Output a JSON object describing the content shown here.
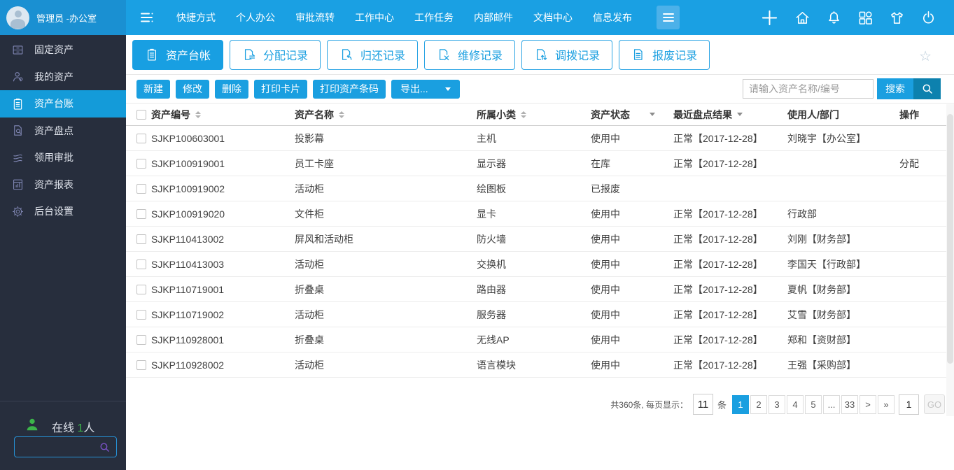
{
  "topbar": {
    "user_name": "管理员 -办公室",
    "menu": [
      "快捷方式",
      "个人办公",
      "审批流转",
      "工作中心",
      "工作任务",
      "内部邮件",
      "文档中心",
      "信息发布"
    ],
    "right_icons": [
      "plus-icon",
      "home-icon",
      "bell-icon",
      "apps-icon",
      "tshirt-icon",
      "power-icon"
    ]
  },
  "sidebar": {
    "items": [
      {
        "label": "固定资产",
        "icon": "cabinet-icon",
        "active": false
      },
      {
        "label": "我的资产",
        "icon": "user-icon",
        "active": false
      },
      {
        "label": "资产台账",
        "icon": "clipboard-icon",
        "active": true
      },
      {
        "label": "资产盘点",
        "icon": "doc-search-icon",
        "active": false
      },
      {
        "label": "领用审批",
        "icon": "layers-icon",
        "active": false
      },
      {
        "label": "资产报表",
        "icon": "report-icon",
        "active": false
      },
      {
        "label": "后台设置",
        "icon": "gear-icon",
        "active": false
      }
    ],
    "online_label": "在线",
    "online_count": "1",
    "online_unit": "人"
  },
  "tabs": [
    {
      "label": "资产台帐",
      "icon": "clipboard-icon",
      "active": true
    },
    {
      "label": "分配记录",
      "icon": "doc-swap-icon",
      "active": false
    },
    {
      "label": "归还记录",
      "icon": "doc-return-icon",
      "active": false
    },
    {
      "label": "维修记录",
      "icon": "doc-repair-icon",
      "active": false
    },
    {
      "label": "调拨记录",
      "icon": "doc-transfer-icon",
      "active": false
    },
    {
      "label": "报废记录",
      "icon": "doc-scrap-icon",
      "active": false
    }
  ],
  "toolbar": {
    "buttons": [
      "新建",
      "修改",
      "删除",
      "打印卡片",
      "打印资产条码"
    ],
    "export_label": "导出...",
    "search_placeholder": "请输入资产名称/编号",
    "search_label": "搜索"
  },
  "table": {
    "columns": [
      {
        "label": "资产编号",
        "sort": true
      },
      {
        "label": "资产名称",
        "sort": true
      },
      {
        "label": "所属小类",
        "sort": true
      },
      {
        "label": "资产状态",
        "filter": "far"
      },
      {
        "label": "最近盘点结果",
        "filter": "near"
      },
      {
        "label": "使用人/部门"
      },
      {
        "label": "操作"
      }
    ],
    "rows": [
      [
        "SJKP100603001",
        "投影幕",
        "主机",
        "使用中",
        "正常【2017-12-28】",
        "刘晓宇【办公室】",
        ""
      ],
      [
        "SJKP100919001",
        "员工卡座",
        "显示器",
        "在库",
        "正常【2017-12-28】",
        "",
        "分配"
      ],
      [
        "SJKP100919002",
        "活动柜",
        "绘图板",
        "已报废",
        "",
        "",
        ""
      ],
      [
        "SJKP100919020",
        "文件柜",
        "显卡",
        "使用中",
        "正常【2017-12-28】",
        "行政部",
        ""
      ],
      [
        "SJKP110413002",
        "屏风和活动柜",
        "防火墙",
        "使用中",
        "正常【2017-12-28】",
        "刘刚【财务部】",
        ""
      ],
      [
        "SJKP110413003",
        "活动柜",
        "交换机",
        "使用中",
        "正常【2017-12-28】",
        "李国天【行政部】",
        ""
      ],
      [
        "SJKP110719001",
        "折叠桌",
        "路由器",
        "使用中",
        "正常【2017-12-28】",
        "夏帆【财务部】",
        ""
      ],
      [
        "SJKP110719002",
        "活动柜",
        "服务器",
        "使用中",
        "正常【2017-12-28】",
        "艾雪【财务部】",
        ""
      ],
      [
        "SJKP110928001",
        "折叠桌",
        "无线AP",
        "使用中",
        "正常【2017-12-28】",
        "郑和【资财部】",
        ""
      ],
      [
        "SJKP110928002",
        "活动柜",
        "语言模块",
        "使用中",
        "正常【2017-12-28】",
        "王强【采购部】",
        ""
      ]
    ]
  },
  "pagination": {
    "total_label": "共360条, 每页显示：",
    "page_size": "11",
    "unit": "条",
    "pages": [
      "1",
      "2",
      "3",
      "4",
      "5",
      "...",
      "33",
      ">",
      "»"
    ],
    "active_page": "1",
    "goto_value": "1",
    "go_label": "GO"
  },
  "colors": {
    "accent": "#1a9fe0",
    "topbar_blue": "#1aa0e3",
    "sidebar_dark": "#272e3d",
    "online_green": "#3cb54a"
  }
}
